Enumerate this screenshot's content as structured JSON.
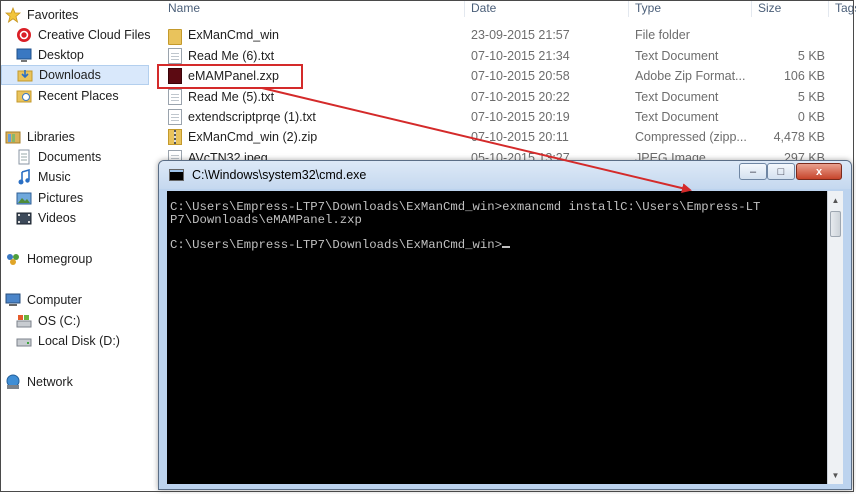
{
  "nav": {
    "favorites": "Favorites",
    "creative_cloud": "Creative Cloud Files",
    "desktop": "Desktop",
    "downloads": "Downloads",
    "recent": "Recent Places",
    "libraries": "Libraries",
    "documents": "Documents",
    "music": "Music",
    "pictures": "Pictures",
    "videos": "Videos",
    "homegroup": "Homegroup",
    "computer": "Computer",
    "os_c": "OS (C:)",
    "local_d": "Local Disk (D:)",
    "network": "Network"
  },
  "columns": {
    "name": "Name",
    "date": "Date",
    "type": "Type",
    "size": "Size",
    "tags": "Tags"
  },
  "files": [
    {
      "name": "ExManCmd_win",
      "date": "23-09-2015 21:57",
      "type": "File folder",
      "size": ""
    },
    {
      "name": "Read Me (6).txt",
      "date": "07-10-2015 21:34",
      "type": "Text Document",
      "size": "5 KB"
    },
    {
      "name": "eMAMPanel.zxp",
      "date": "07-10-2015 20:58",
      "type": "Adobe Zip Format...",
      "size": "106 KB"
    },
    {
      "name": "Read Me (5).txt",
      "date": "07-10-2015 20:22",
      "type": "Text Document",
      "size": "5 KB"
    },
    {
      "name": "extendscriptprqe (1).txt",
      "date": "07-10-2015 20:19",
      "type": "Text Document",
      "size": "0 KB"
    },
    {
      "name": "ExManCmd_win (2).zip",
      "date": "07-10-2015 20:11",
      "type": "Compressed (zipp...",
      "size": "4,478 KB"
    },
    {
      "name": "AVcTN32.jpeg",
      "date": "05-10-2015 13:27",
      "type": "JPEG Image",
      "size": "297 KB"
    }
  ],
  "cmd": {
    "title": "C:\\Windows\\system32\\cmd.exe",
    "line1": "C:\\Users\\Empress-LTP7\\Downloads\\ExManCmd_win>exmancmd installC:\\Users\\Empress-LT",
    "line2": "P7\\Downloads\\eMAMPanel.zxp",
    "line3": "C:\\Users\\Empress-LTP7\\Downloads\\ExManCmd_win>",
    "minimize": "–",
    "maximize": "□",
    "close": "x"
  },
  "colors": {
    "highlight": "#d42a2a",
    "selection": "#d9e8fb",
    "console_bg": "#000000",
    "console_fg": "#c0c0c0"
  }
}
